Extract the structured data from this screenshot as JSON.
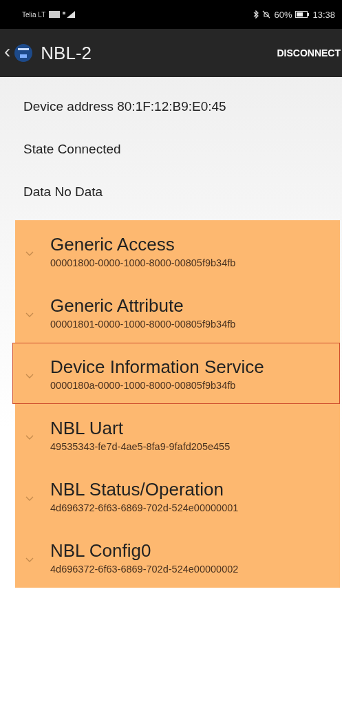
{
  "status_bar": {
    "carrier": "Telia LT",
    "battery": "60%",
    "time": "13:38"
  },
  "app_bar": {
    "back": "‹",
    "title": "NBL-2",
    "action": "DISCONNECT"
  },
  "info": [
    {
      "label": "Device address",
      "value": "80:1F:12:B9:E0:45"
    },
    {
      "label": "State",
      "value": "Connected"
    },
    {
      "label": "Data",
      "value": "No Data"
    }
  ],
  "services": [
    {
      "name": "Generic Access",
      "uuid": "00001800-0000-1000-8000-00805f9b34fb",
      "selected": false
    },
    {
      "name": "Generic Attribute",
      "uuid": "00001801-0000-1000-8000-00805f9b34fb",
      "selected": false
    },
    {
      "name": "Device Information Service",
      "uuid": "0000180a-0000-1000-8000-00805f9b34fb",
      "selected": true
    },
    {
      "name": "NBL Uart",
      "uuid": "49535343-fe7d-4ae5-8fa9-9fafd205e455",
      "selected": false
    },
    {
      "name": "NBL Status/Operation",
      "uuid": "4d696372-6f63-6869-702d-524e00000001",
      "selected": false
    },
    {
      "name": "NBL Config0",
      "uuid": "4d696372-6f63-6869-702d-524e00000002",
      "selected": false
    }
  ]
}
